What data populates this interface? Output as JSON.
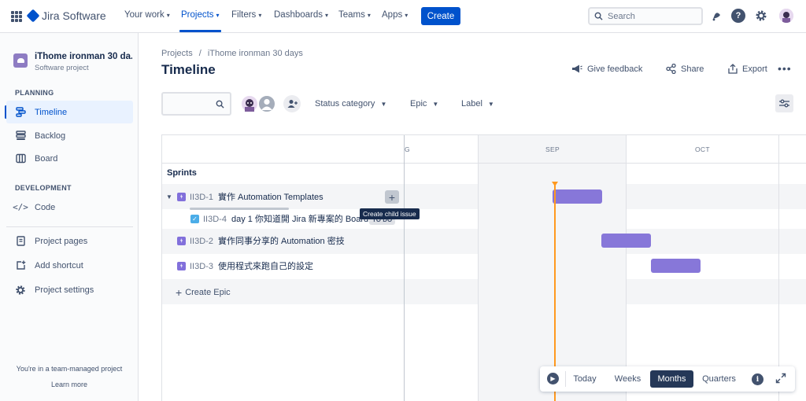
{
  "topnav": {
    "product": "Jira Software",
    "items": [
      {
        "label": "Your work",
        "active": false
      },
      {
        "label": "Projects",
        "active": true
      },
      {
        "label": "Filters",
        "active": false
      },
      {
        "label": "Dashboards",
        "active": false
      },
      {
        "label": "Teams",
        "active": false
      },
      {
        "label": "Apps",
        "active": false
      }
    ],
    "create_label": "Create",
    "search_placeholder": "Search",
    "accent": "#0052cc"
  },
  "sidebar": {
    "project_name": "iThome ironman 30 da...",
    "project_type": "Software project",
    "planning_heading": "PLANNING",
    "development_heading": "DEVELOPMENT",
    "items": [
      {
        "label": "Timeline",
        "icon": "timeline-icon",
        "active": true
      },
      {
        "label": "Backlog",
        "icon": "backlog-icon"
      },
      {
        "label": "Board",
        "icon": "board-icon"
      },
      {
        "label": "Code",
        "icon": "code-icon"
      },
      {
        "label": "Project pages",
        "icon": "page-icon"
      },
      {
        "label": "Add shortcut",
        "icon": "add-shortcut-icon"
      },
      {
        "label": "Project settings",
        "icon": "gear-icon"
      }
    ],
    "footer_text": "You're in a team-managed project",
    "learn_more": "Learn more"
  },
  "header": {
    "breadcrumb": [
      "Projects",
      "/",
      "iThome ironman 30 days"
    ],
    "title": "Timeline",
    "actions": {
      "feedback": "Give feedback",
      "share": "Share",
      "export": "Export"
    }
  },
  "toolbar": {
    "filters": [
      "Status category",
      "Epic",
      "Label"
    ]
  },
  "timeline": {
    "months": [
      "G",
      "SEP",
      "OCT"
    ],
    "sprints_label": "Sprints",
    "rows": [
      {
        "type": "epic",
        "key": "II3D-1",
        "summary": "實作 Automation Templates",
        "expanded": true
      },
      {
        "type": "task",
        "key": "II3D-4",
        "summary": "day 1 你知道開 Jira 新專案的 Board...",
        "status": "TO DO"
      },
      {
        "type": "epic",
        "key": "II3D-2",
        "summary": "實作同事分享的 Automation 密技"
      },
      {
        "type": "epic",
        "key": "II3D-3",
        "summary": "使用程式來跑自己的設定"
      }
    ],
    "tooltip": "Create child issue",
    "create_epic": "Create Epic",
    "bar_color": "#8777d9",
    "today_color": "#ff991f"
  },
  "zoom": {
    "options": [
      "Today",
      "Weeks",
      "Months",
      "Quarters"
    ],
    "active": "Months"
  }
}
